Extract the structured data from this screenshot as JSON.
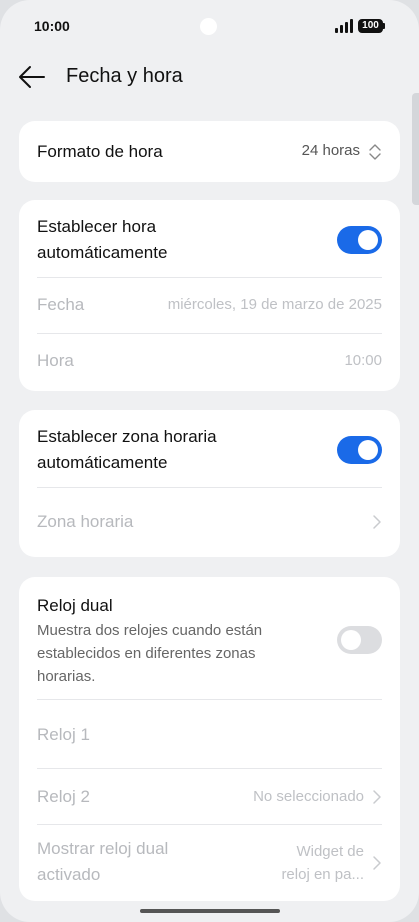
{
  "status": {
    "time": "10:00",
    "battery": "100"
  },
  "header": {
    "title": "Fecha y hora"
  },
  "time_format": {
    "label": "Formato de hora",
    "value": "24 horas"
  },
  "auto_time": {
    "label_line1": "Establecer hora",
    "label_line2": "automáticamente",
    "enabled": true,
    "date_label": "Fecha",
    "date_value": "miércoles, 19 de marzo de 2025",
    "time_label": "Hora",
    "time_value": "10:00"
  },
  "auto_zone": {
    "label_line1": "Establecer zona horaria",
    "label_line2": "automáticamente",
    "enabled": true,
    "zone_label": "Zona horaria"
  },
  "dual_clock": {
    "title": "Reloj dual",
    "desc_line1": "Muestra dos relojes cuando están",
    "desc_line2": "establecidos en diferentes zonas",
    "desc_line3": "horarias.",
    "enabled": false,
    "clock1_label": "Reloj 1",
    "clock2_label": "Reloj 2",
    "clock2_value": "No seleccionado",
    "show_label_line1": "Mostrar reloj dual",
    "show_label_line2": "activado",
    "show_value_line1": "Widget de",
    "show_value_line2": "reloj en pa..."
  },
  "colors": {
    "accent": "#1a6ae8",
    "background": "#eff0f2",
    "card": "#ffffff"
  }
}
